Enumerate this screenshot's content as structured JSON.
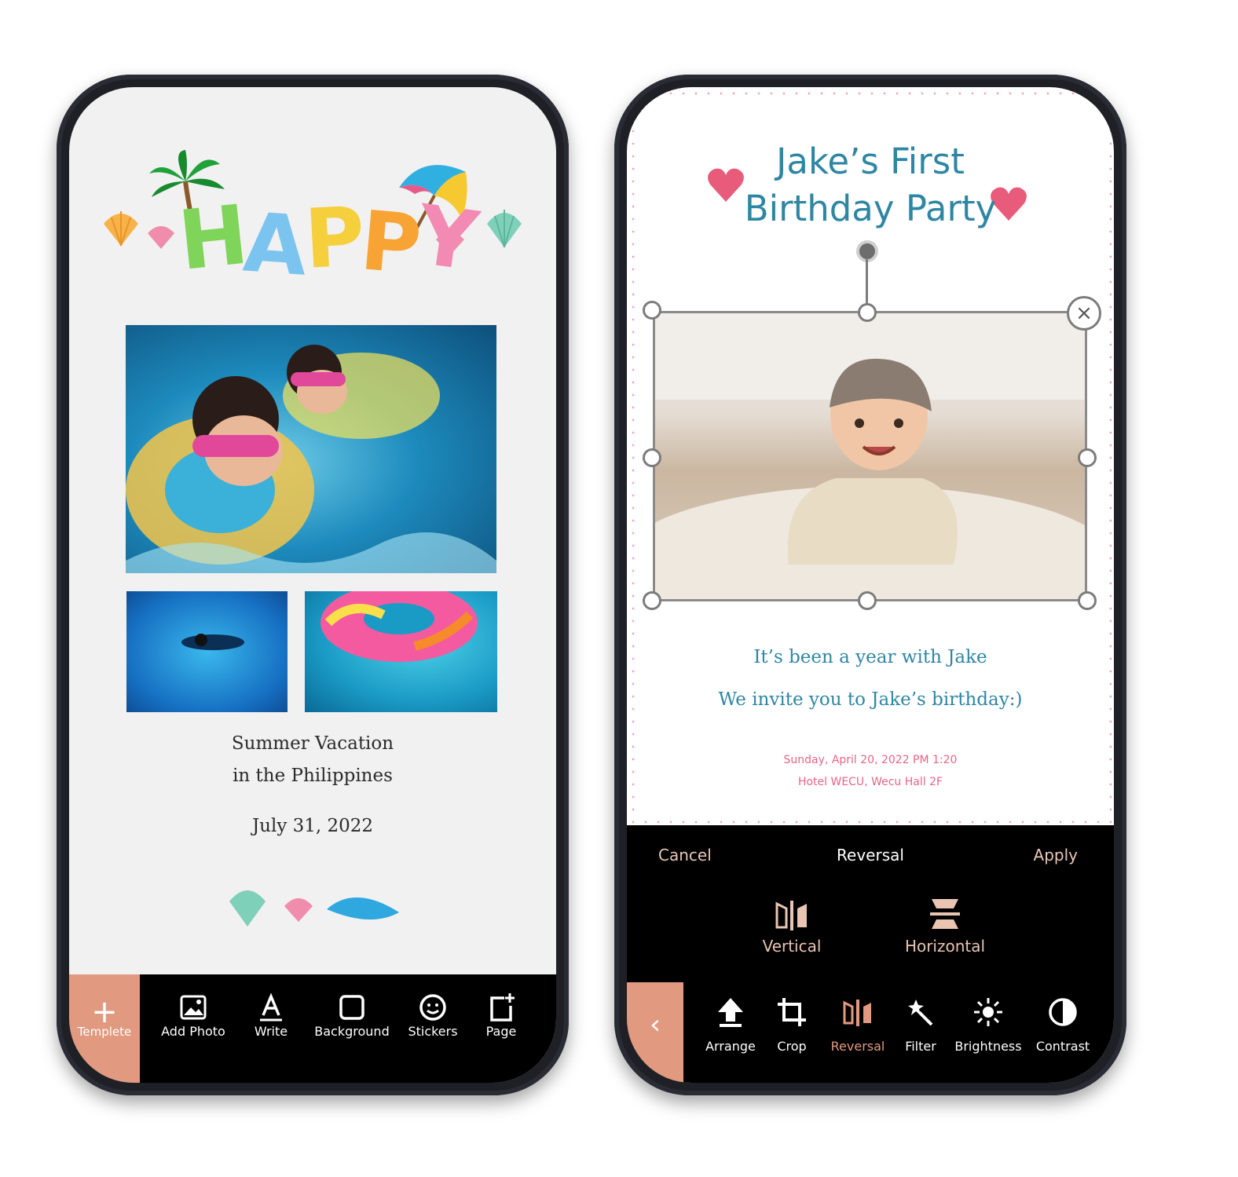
{
  "left_screen": {
    "header_title": "HAPPY",
    "caption": {
      "line1": "Summer Vacation",
      "line2": "in the Philippines",
      "date": "July 31, 2022"
    },
    "toolbar": {
      "templete": "Templete",
      "add_photo": "Add Photo",
      "write": "Write",
      "background": "Background",
      "stickers": "Stickers",
      "page": "Page"
    }
  },
  "right_screen": {
    "title_line1": "Jake’s First",
    "title_line2": "Birthday Party",
    "invite_line1": "It’s been a year with Jake",
    "invite_line2": "We invite you to Jake’s birthday:)",
    "event_when": "Sunday, April 20, 2022 PM 1:20",
    "event_where": "Hotel WECU, Wecu Hall 2F",
    "panel": {
      "cancel": "Cancel",
      "title": "Reversal",
      "apply": "Apply",
      "vertical": "Vertical",
      "horizontal": "Horizontal"
    },
    "edit_toolbar": {
      "arrange": "Arrange",
      "crop": "Crop",
      "reversal": "Reversal",
      "filter": "Filter",
      "brightness": "Brightness",
      "contrast": "Contrast"
    }
  },
  "colors": {
    "accent": "#e19a7f",
    "title_blue": "#2e86a3",
    "event_pink": "#e76487",
    "heart": "#e85b7a"
  }
}
